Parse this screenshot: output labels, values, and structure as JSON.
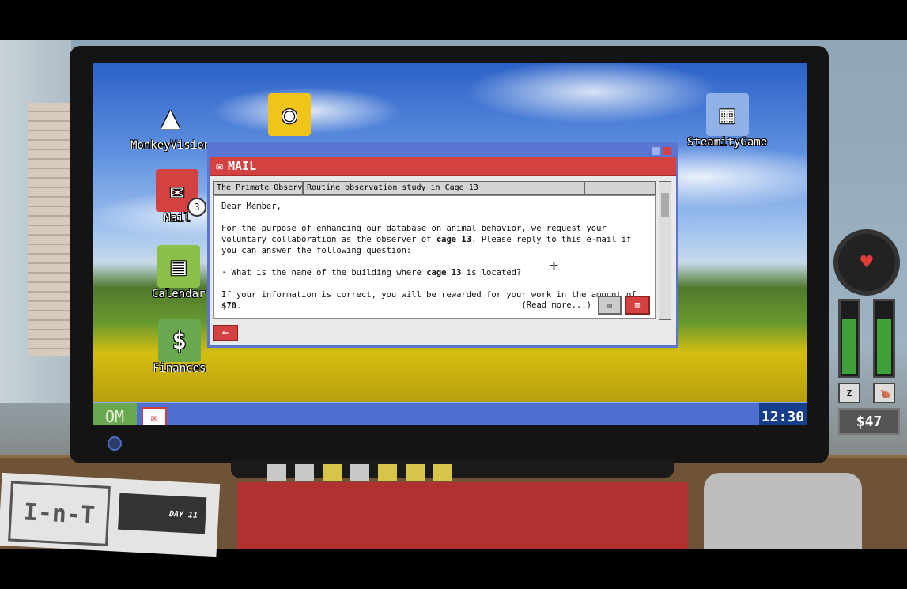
{
  "desktop": {
    "icons": [
      {
        "label": "MonkeyVision",
        "icon": "monkey-icon"
      },
      {
        "label": "",
        "icon": "globe-icon"
      },
      {
        "label": "SteamityGame",
        "icon": "grid-icon"
      },
      {
        "label": "Mail",
        "icon": "mail-icon",
        "badge": "3"
      },
      {
        "label": "Calendar",
        "icon": "calendar-icon"
      },
      {
        "label": "Finances",
        "icon": "dollar-icon"
      }
    ]
  },
  "mail_window": {
    "title": "MAIL",
    "tabs": [
      "The Primate Observa...",
      "Routine observation study in Cage 13",
      ""
    ],
    "body": {
      "greeting": "Dear Member,",
      "para1_a": "For the purpose of enhancing our database on animal behavior, we request your voluntary collaboration as the observer of ",
      "para1_b": "cage 13",
      "para1_c": ". Please reply to this e-mail if you can answer the following question:",
      "question_a": "· What is the name of the building where ",
      "question_b": "cage 13",
      "question_c": " is located?",
      "reward_a": "If your information is correct, you will be rewarded for your work in the amount of ",
      "reward_b": "$70",
      "reward_c": ".",
      "read_more": "(Read more...)"
    }
  },
  "taskbar": {
    "start_label": "OM",
    "clock": "12:30"
  },
  "hud": {
    "money": "$47",
    "sleep_level": 0.75,
    "food_level": 0.75
  },
  "newspaper": {
    "logo": "I-n-T",
    "day": "DAY 11"
  },
  "colors": {
    "mail_red": "#d34141",
    "window_blue": "#5b75d2",
    "taskbar_blue": "#4e6fd0",
    "om_green": "#6aa84f",
    "gauge_green": "#3ea13a"
  }
}
